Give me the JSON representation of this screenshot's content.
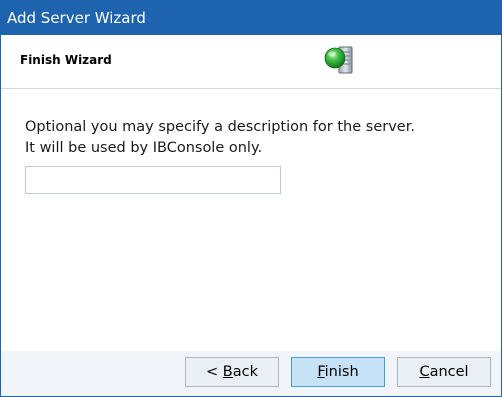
{
  "window": {
    "title": "Add Server Wizard"
  },
  "header": {
    "heading": "Finish Wizard",
    "icon": "server-globe-icon"
  },
  "content": {
    "line1": "Optional you may specify a description for the server.",
    "line2": "It will be used by IBConsole only.",
    "description_value": ""
  },
  "buttons": {
    "back": {
      "prefix": "< ",
      "mnemonic": "B",
      "rest": "ack"
    },
    "finish": {
      "prefix": "",
      "mnemonic": "F",
      "rest": "inish"
    },
    "cancel": {
      "prefix": "",
      "mnemonic": "C",
      "rest": "ancel"
    }
  },
  "colors": {
    "titlebar": "#1e63ad",
    "footer": "#f1f4f9",
    "default_button": "#c6e2f7",
    "button": "#e9eff5"
  }
}
